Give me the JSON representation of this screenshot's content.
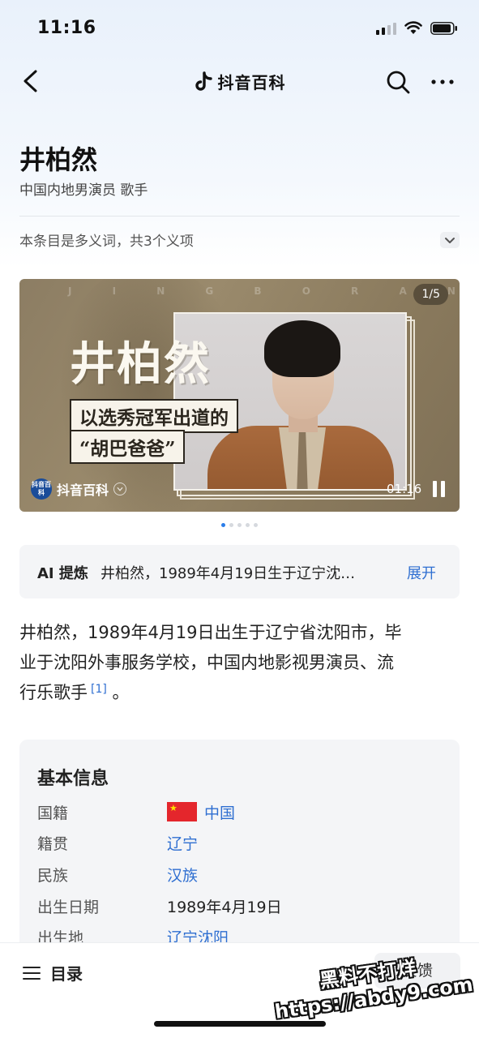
{
  "status_bar": {
    "time": "11:16"
  },
  "nav": {
    "brand": "抖音百科",
    "icons": [
      "back-arrow-icon",
      "tiktok-logo-icon",
      "search-icon",
      "more-icon"
    ]
  },
  "entry": {
    "title": "井柏然",
    "subtitle": "中国内地男演员 歌手"
  },
  "polysemy": {
    "text": "本条目是多义词，共3个义项"
  },
  "video": {
    "letters": [
      "J",
      "I",
      "N",
      "G",
      "B",
      "O",
      "R",
      "A",
      "N"
    ],
    "big_title": "井柏然",
    "caption_line1": "以选秀冠军出道的",
    "caption_line2": "“胡巴爸爸”",
    "counter": "1/5",
    "source": "抖音百科",
    "source_logo": "抖音百科",
    "duration": "01:16",
    "current_slide": 1,
    "total_slides": 5
  },
  "ai_summary": {
    "label": "AI 提炼",
    "text": "井柏然，1989年4月19日生于辽宁沈…",
    "expand": "展开"
  },
  "summary": {
    "line1": "井柏然，1989年4月19日出生于辽宁省沈阳市，毕",
    "line2": "业于沈阳外事服务学校，中国内地影视男演员、流",
    "line3_text": "行乐歌手",
    "ref": "[1]",
    "end": "。"
  },
  "basic_info": {
    "title": "基本信息",
    "rows": [
      {
        "key": "国籍",
        "value": "中国",
        "link": true,
        "flag": "china-flag-icon"
      },
      {
        "key": "籍贯",
        "value": "辽宁",
        "link": true
      },
      {
        "key": "民族",
        "value": "汉族",
        "link": true
      },
      {
        "key": "出生日期",
        "value": "1989年4月19日",
        "link": false
      },
      {
        "key": "出生地",
        "value": "辽宁沈阳",
        "link": true
      }
    ]
  },
  "bottom_bar": {
    "toc_label": "目录",
    "feedback_label": "反馈"
  },
  "watermark": {
    "line1": "黑料不打烊",
    "line2": "https://abdy9.com"
  },
  "colors": {
    "link": "#2f6fd1",
    "accent_dot": "#2b7de9",
    "card_bg": "#f4f5f7"
  }
}
